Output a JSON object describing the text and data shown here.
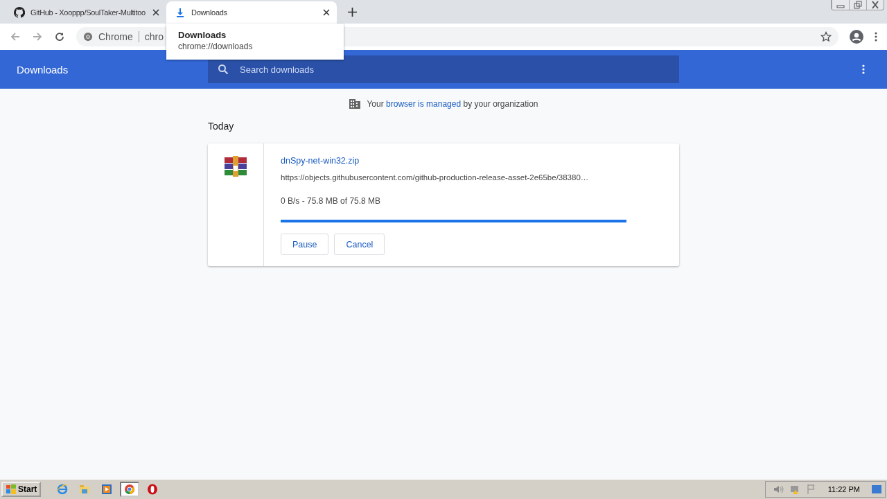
{
  "tabs": [
    {
      "title": "GitHub - Xooppp/SoulTaker-Multitoo",
      "kind": "github",
      "selected": false
    },
    {
      "title": "Downloads",
      "kind": "download",
      "selected": true
    }
  ],
  "omnibox": {
    "site": "Chrome",
    "url": "chro"
  },
  "tooltip": {
    "title": "Downloads",
    "url": "chrome://downloads"
  },
  "header": {
    "title": "Downloads",
    "search_placeholder": "Search downloads"
  },
  "managed_notice": {
    "before": "Your",
    "link": "browser is managed",
    "after": "by your organization"
  },
  "section": "Today",
  "downloads": [
    {
      "file": "dnSpy-net-win32.zip",
      "url": "https://objects.githubusercontent.com/github-production-release-asset-2e65be/38380…",
      "status": "0 B/s - 75.8 MB of 75.8 MB",
      "level": 1,
      "buttons": [
        "Pause",
        "Cancel"
      ]
    }
  ],
  "taskbar": {
    "start": "Start",
    "apps": [
      {
        "kind": "ie",
        "selected": false
      },
      {
        "kind": "explorer",
        "selected": false
      },
      {
        "kind": "media",
        "selected": false
      },
      {
        "kind": "chrome",
        "selected": true
      },
      {
        "kind": "opera",
        "selected": false
      }
    ],
    "time": "11:22 PM"
  }
}
